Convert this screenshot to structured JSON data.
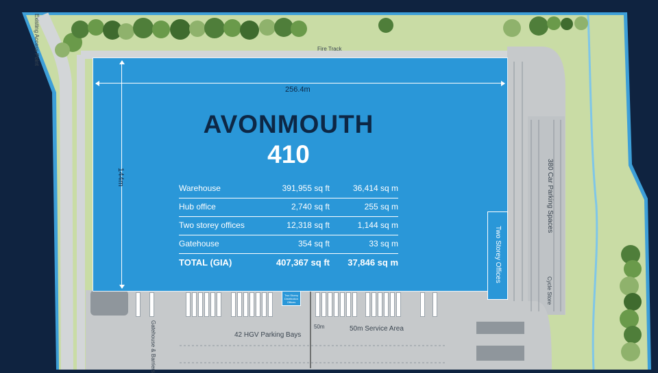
{
  "title": {
    "line1": "AVONMOUTH",
    "line2": "410"
  },
  "dimensions": {
    "width": "256.4m",
    "depth": "144m",
    "yard_depth": "50m"
  },
  "area_schedule": [
    {
      "name": "Warehouse",
      "sqft": "391,955 sq ft",
      "sqm": "36,414 sq m"
    },
    {
      "name": "Hub office",
      "sqft": "2,740 sq ft",
      "sqm": "255 sq m"
    },
    {
      "name": "Two storey offices",
      "sqft": "12,318 sq ft",
      "sqm": "1,144 sq m"
    },
    {
      "name": "Gatehouse",
      "sqft": "354 sq ft",
      "sqm": "33 sq m"
    }
  ],
  "total": {
    "name": "TOTAL (GIA)",
    "sqft": "407,367 sq ft",
    "sqm": "37,846 sq m"
  },
  "labels": {
    "fire_track": "Fire Track",
    "access_point": "Existing Access Point",
    "two_storey_offices": "Two Storey Offices",
    "distribution_offices": "Two Storey Distribution Offices",
    "car_parking": "380 Car Parking Spaces",
    "cycle_store": "Cycle Store",
    "hgv_bays": "42 HGV Parking Bays",
    "service_area": "50m Service Area",
    "gatehouse": "Gatehouse & Barriers"
  },
  "colors": {
    "background": "#0f2340",
    "site_green": "#c9dca5",
    "hardstanding": "#c6c9cb",
    "building": "#2a97d8",
    "title_dark": "#0d2745",
    "boundary_blue": "#3d9fd8"
  }
}
